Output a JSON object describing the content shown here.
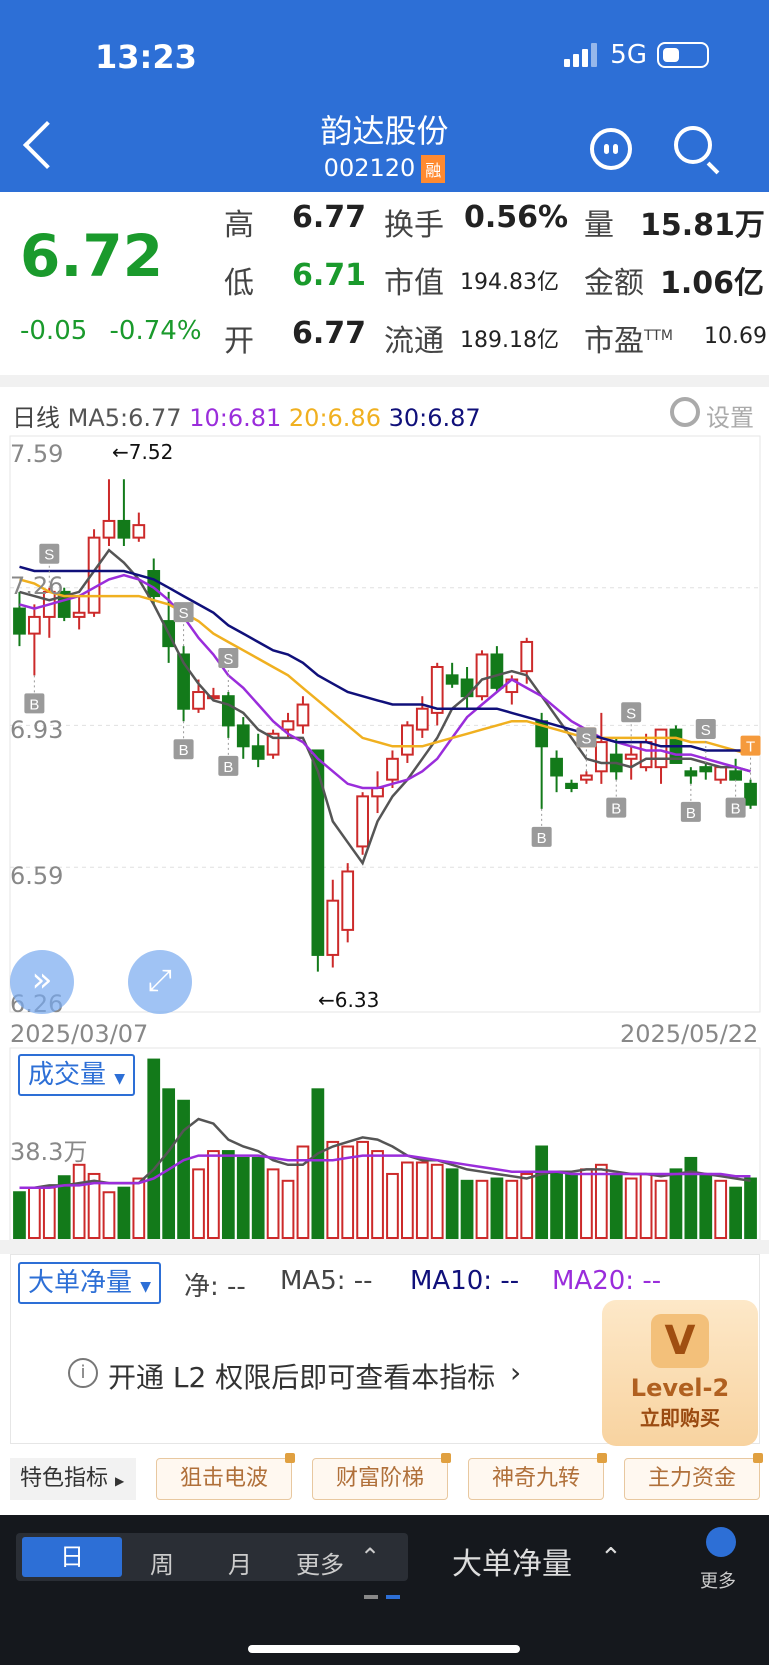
{
  "status": {
    "time": "13:23",
    "network": "5G"
  },
  "nav": {
    "title": "韵达股份",
    "code": "002120",
    "badge": "融"
  },
  "quote": {
    "price": "6.72",
    "change": "-0.05",
    "change_pct": "-0.74%",
    "high_label": "高",
    "high": "6.77",
    "low_label": "低",
    "low": "6.71",
    "open_label": "开",
    "open": "6.77",
    "turnover_label": "换手",
    "turnover": "0.56%",
    "mktcap_label": "市值",
    "mktcap": "194.83亿",
    "float_label": "流通",
    "float": "189.18亿",
    "volume_label": "量",
    "volume": "15.81万",
    "amount_label": "金额",
    "amount": "1.06亿",
    "pe_label": "市盈",
    "pe_sup": "TTM",
    "pe": "10.69"
  },
  "kline_legend": {
    "period": "日线",
    "ma5": "MA5:6.77",
    "ma10": "10:6.81",
    "ma20": "20:6.86",
    "ma30": "30:6.87",
    "settings": "设置"
  },
  "colors": {
    "up": "#cc2a2a",
    "down": "#137a1a",
    "ma5": "#555555",
    "ma10": "#9a2ddb",
    "ma20": "#f0b020",
    "ma30": "#10107a",
    "accent": "#2d6fd6"
  },
  "chart_data": [
    {
      "type": "candlestick",
      "ylim": [
        6.26,
        7.59
      ],
      "yticks": [
        "7.59",
        "7.26",
        "6.93",
        "6.59",
        "6.26"
      ],
      "x_start": "2025/03/07",
      "x_end": "2025/05/22",
      "max_label": "←7.52",
      "min_label": "←6.33",
      "candles": [
        [
          7.21,
          7.25,
          7.12,
          7.15
        ],
        [
          7.15,
          7.22,
          7.05,
          7.19
        ],
        [
          7.19,
          7.26,
          7.14,
          7.25
        ],
        [
          7.25,
          7.26,
          7.18,
          7.19
        ],
        [
          7.19,
          7.24,
          7.16,
          7.2
        ],
        [
          7.2,
          7.4,
          7.19,
          7.38
        ],
        [
          7.38,
          7.52,
          7.36,
          7.42
        ],
        [
          7.42,
          7.52,
          7.36,
          7.38
        ],
        [
          7.38,
          7.44,
          7.37,
          7.41
        ],
        [
          7.3,
          7.33,
          7.22,
          7.24
        ],
        [
          7.18,
          7.25,
          7.08,
          7.12
        ],
        [
          7.1,
          7.12,
          6.94,
          6.97
        ],
        [
          6.97,
          7.04,
          6.96,
          7.01
        ],
        [
          7.0,
          7.02,
          6.99,
          7.0
        ],
        [
          7.0,
          7.01,
          6.9,
          6.93
        ],
        [
          6.93,
          6.95,
          6.85,
          6.88
        ],
        [
          6.88,
          6.91,
          6.83,
          6.85
        ],
        [
          6.86,
          6.92,
          6.85,
          6.91
        ],
        [
          6.92,
          6.96,
          6.9,
          6.94
        ],
        [
          6.93,
          7.0,
          6.91,
          6.98
        ],
        [
          6.87,
          6.87,
          6.34,
          6.38
        ],
        [
          6.38,
          6.56,
          6.35,
          6.51
        ],
        [
          6.44,
          6.6,
          6.41,
          6.58
        ],
        [
          6.64,
          6.77,
          6.62,
          6.76
        ],
        [
          6.76,
          6.82,
          6.72,
          6.78
        ],
        [
          6.8,
          6.87,
          6.78,
          6.85
        ],
        [
          6.86,
          6.94,
          6.84,
          6.93
        ],
        [
          6.92,
          7.0,
          6.9,
          6.97
        ],
        [
          6.96,
          7.08,
          6.93,
          7.07
        ],
        [
          7.05,
          7.08,
          7.02,
          7.03
        ],
        [
          7.04,
          7.07,
          6.97,
          7.0
        ],
        [
          7.0,
          7.11,
          6.99,
          7.1
        ],
        [
          7.1,
          7.12,
          7.01,
          7.02
        ],
        [
          7.01,
          7.05,
          6.98,
          7.04
        ],
        [
          7.06,
          7.14,
          7.03,
          7.13
        ],
        [
          6.94,
          6.96,
          6.73,
          6.88
        ],
        [
          6.85,
          6.87,
          6.77,
          6.81
        ],
        [
          6.79,
          6.8,
          6.77,
          6.78
        ],
        [
          6.8,
          6.82,
          6.79,
          6.81
        ],
        [
          6.82,
          6.96,
          6.79,
          6.89
        ],
        [
          6.86,
          6.9,
          6.8,
          6.82
        ],
        [
          6.85,
          6.88,
          6.8,
          6.86
        ],
        [
          6.83,
          6.91,
          6.82,
          6.89
        ],
        [
          6.83,
          6.92,
          6.79,
          6.92
        ],
        [
          6.92,
          6.93,
          6.85,
          6.84
        ],
        [
          6.82,
          6.83,
          6.79,
          6.81
        ],
        [
          6.83,
          6.84,
          6.8,
          6.82
        ],
        [
          6.8,
          6.83,
          6.79,
          6.83
        ],
        [
          6.82,
          6.85,
          6.8,
          6.8
        ],
        [
          6.79,
          6.8,
          6.73,
          6.74
        ]
      ],
      "ma5": [
        7.25,
        7.24,
        7.23,
        7.24,
        7.25,
        7.3,
        7.35,
        7.32,
        7.28,
        7.22,
        7.15,
        7.08,
        7.03,
        6.99,
        6.98,
        6.96,
        6.92,
        6.9,
        6.9,
        6.9,
        6.82,
        6.7,
        6.65,
        6.6,
        6.7,
        6.76,
        6.8,
        6.85,
        6.9,
        6.97,
        7.0,
        7.04,
        7.05,
        7.06,
        7.05,
        7.0,
        6.95,
        6.9,
        6.85,
        6.84,
        6.84,
        6.83,
        6.85,
        6.85,
        6.85,
        6.85,
        6.84,
        6.83,
        6.83,
        6.82
      ],
      "ma10": [
        7.22,
        7.21,
        7.22,
        7.23,
        7.24,
        7.26,
        7.28,
        7.29,
        7.28,
        7.26,
        7.23,
        7.19,
        7.14,
        7.1,
        7.05,
        7.02,
        6.98,
        6.94,
        6.91,
        6.89,
        6.85,
        6.82,
        6.79,
        6.78,
        6.78,
        6.79,
        6.8,
        6.82,
        6.85,
        6.9,
        6.95,
        6.98,
        7.01,
        7.04,
        7.02,
        7.0,
        6.97,
        6.94,
        6.92,
        6.9,
        6.89,
        6.88,
        6.87,
        6.87,
        6.86,
        6.86,
        6.85,
        6.84,
        6.83,
        6.82
      ],
      "ma20": [
        7.28,
        7.27,
        7.25,
        7.24,
        7.24,
        7.24,
        7.24,
        7.24,
        7.24,
        7.23,
        7.22,
        7.2,
        7.18,
        7.15,
        7.13,
        7.11,
        7.09,
        7.07,
        7.05,
        7.02,
        6.99,
        6.96,
        6.93,
        6.9,
        6.89,
        6.88,
        6.88,
        6.88,
        6.89,
        6.9,
        6.91,
        6.92,
        6.93,
        6.94,
        6.94,
        6.93,
        6.92,
        6.91,
        6.9,
        6.9,
        6.9,
        6.9,
        6.9,
        6.9,
        6.9,
        6.89,
        6.89,
        6.88,
        6.87,
        6.86
      ],
      "ma30": [
        7.31,
        7.3,
        7.3,
        7.3,
        7.3,
        7.3,
        7.3,
        7.3,
        7.29,
        7.28,
        7.26,
        7.24,
        7.22,
        7.2,
        7.17,
        7.15,
        7.13,
        7.11,
        7.1,
        7.08,
        7.05,
        7.03,
        7.01,
        7.0,
        6.99,
        6.98,
        6.98,
        6.98,
        6.97,
        6.97,
        6.97,
        6.97,
        6.97,
        6.96,
        6.95,
        6.94,
        6.93,
        6.92,
        6.91,
        6.9,
        6.89,
        6.89,
        6.89,
        6.88,
        6.88,
        6.88,
        6.87,
        6.87,
        6.87,
        6.87
      ],
      "signals": [
        {
          "i": 1,
          "t": "B"
        },
        {
          "i": 2,
          "t": "S"
        },
        {
          "i": 11,
          "t": "S"
        },
        {
          "i": 11,
          "t": "B"
        },
        {
          "i": 14,
          "t": "B"
        },
        {
          "i": 14,
          "t": "S"
        },
        {
          "i": 35,
          "t": "B"
        },
        {
          "i": 38,
          "t": "T"
        },
        {
          "i": 38,
          "t": "S"
        },
        {
          "i": 40,
          "t": "B"
        },
        {
          "i": 41,
          "t": "S"
        },
        {
          "i": 45,
          "t": "B"
        },
        {
          "i": 46,
          "t": "S"
        },
        {
          "i": 48,
          "t": "B"
        },
        {
          "i": 49,
          "t": "T"
        }
      ]
    },
    {
      "type": "bar",
      "name": "成交量",
      "ytick": "38.3万",
      "values": [
        20,
        22,
        22,
        27,
        32,
        28,
        20,
        22,
        26,
        78,
        65,
        60,
        30,
        38,
        38,
        35,
        35,
        30,
        25,
        40,
        65,
        42,
        40,
        42,
        38,
        28,
        33,
        33,
        32,
        30,
        25,
        25,
        26,
        25,
        28,
        40,
        28,
        28,
        30,
        32,
        28,
        26,
        28,
        25,
        30,
        35,
        28,
        25,
        22,
        26
      ],
      "ma5": [
        22,
        22,
        23,
        23,
        24,
        25,
        24,
        24,
        24,
        30,
        38,
        47,
        52,
        50,
        43,
        40,
        38,
        34,
        32,
        32,
        37,
        40,
        42,
        44,
        43,
        40,
        36,
        34,
        34,
        32,
        30,
        29,
        28,
        27,
        26,
        28,
        29,
        29,
        30,
        30,
        29,
        28,
        28,
        27,
        28,
        29,
        28,
        27,
        26,
        25
      ],
      "ma10": [
        22,
        22,
        22,
        23,
        23,
        24,
        24,
        24,
        24,
        26,
        30,
        34,
        36,
        36,
        36,
        36,
        36,
        35,
        34,
        34,
        34,
        34,
        35,
        36,
        36,
        36,
        36,
        35,
        34,
        33,
        32,
        31,
        30,
        29,
        29,
        29,
        29,
        28,
        28,
        28,
        28,
        28,
        28,
        28,
        28,
        28,
        28,
        28,
        27,
        27
      ]
    }
  ],
  "volume_panel": {
    "selector": "成交量"
  },
  "bigorder_panel": {
    "selector": "大单净量",
    "net": "净: --",
    "ma5": "MA5: --",
    "ma10": "MA10: --",
    "ma20": "MA20: --",
    "notice": "开通 L2 权限后即可查看本指标"
  },
  "level2": {
    "logo": "V",
    "title": "Level-2",
    "cta": "立即购买"
  },
  "features": {
    "label": "特色指标",
    "items": [
      "狙击电波",
      "财富阶梯",
      "神奇九转",
      "主力资金"
    ]
  },
  "bottom": {
    "tabs": [
      "日",
      "周",
      "月",
      "更多"
    ],
    "indicator": "大单净量",
    "more": "更多"
  }
}
